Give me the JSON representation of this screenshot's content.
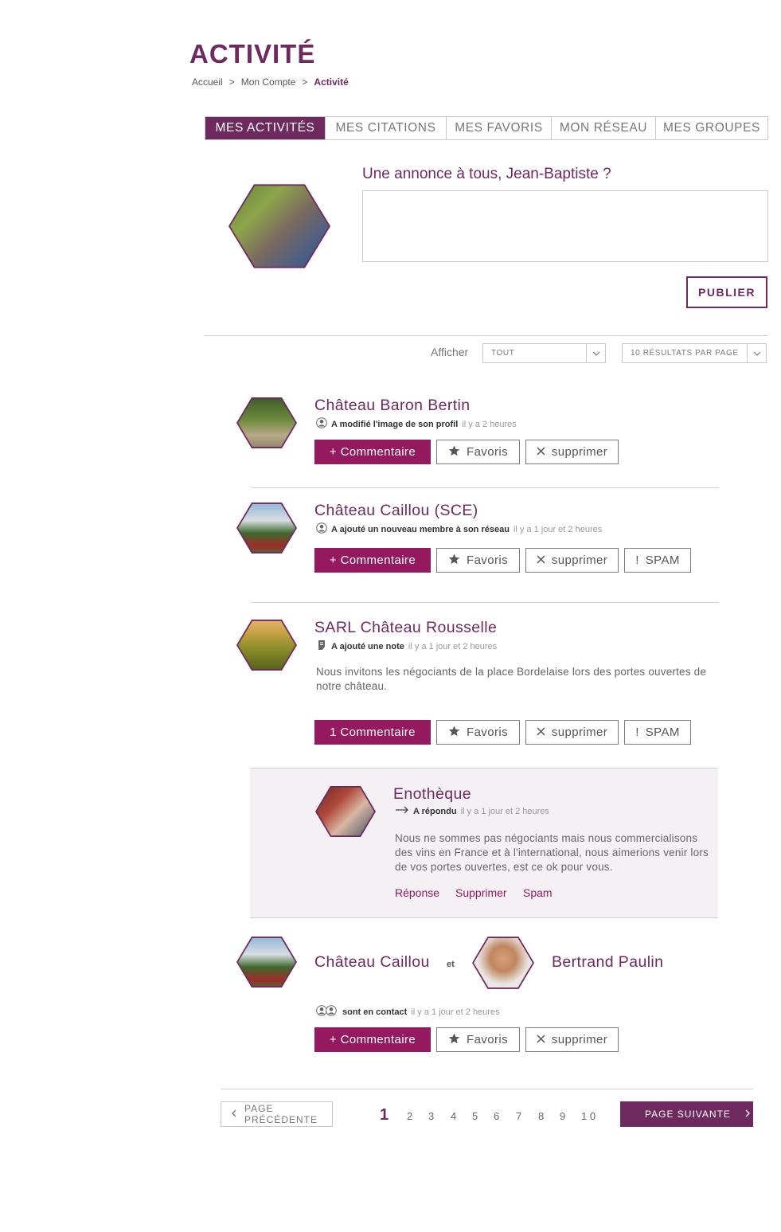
{
  "page": {
    "title": "ACTIVITÉ",
    "breadcrumb": [
      "Accueil",
      ">",
      "Mon Compte",
      ">",
      "Activité"
    ]
  },
  "tabs": [
    "MES ACTIVITÉS",
    "MES CITATIONS",
    "MES FAVORIS",
    "MON RÉSEAU",
    "MES GROUPES"
  ],
  "composer": {
    "label": "Une annonce à tous, Jean-Baptiste ?",
    "value": "",
    "publish": "PUBLIER"
  },
  "filters": {
    "afficher": "Afficher",
    "type": "TOUT",
    "per_page": "10 RÉSULTATS PAR PAGE"
  },
  "feed": [
    {
      "name": "Château Baron Bertin",
      "action": "A modifié l'image de son profil",
      "time": "il y a  2 heures",
      "buttons": [
        "+ Commentaire",
        "Favoris",
        "supprimer"
      ]
    },
    {
      "name": "Château Caillou (SCE)",
      "action": "A ajouté un nouveau membre à son réseau",
      "time": "il y a 1 jour et 2 heures",
      "buttons": [
        "+ Commentaire",
        "Favoris",
        "supprimer",
        "SPAM"
      ]
    },
    {
      "name": "SARL Château Rousselle",
      "action": "A ajouté une note",
      "time": "il y a 1 jour et 2 heures",
      "text": "Nous invitons les négociants de la place Bordelaise lors des portes ouvertes de notre château.",
      "buttons": [
        "1  Commentaire",
        "Favoris",
        "supprimer",
        "SPAM"
      ]
    },
    {
      "name": "Enothèque",
      "action": "A répondu",
      "time": "il y a 1 jour et 2 heures",
      "text": "Nous ne sommes pas négociants mais nous commercialisons des vins en France et à l'international, nous aimerions venir lors de vos portes ouvertes, est ce ok pour vous.",
      "links": [
        "Réponse",
        "Supprimer",
        "Spam"
      ]
    },
    {
      "name": "Château Caillou",
      "connector": "et",
      "name2": "Bertrand Paulin",
      "action": "sont en contact",
      "time": "il y a 1 jour et 2 heures",
      "buttons": [
        "+ Commentaire",
        "Favoris",
        "supprimer"
      ]
    }
  ],
  "pagination": {
    "prev": "PAGE PRÉCÉDENTE",
    "next": "PAGE SUIVANTE",
    "pages": [
      "1",
      "2",
      "3",
      "4",
      "5",
      "6",
      "7",
      "8",
      "9",
      "1 0"
    ],
    "current": 1
  },
  "colors": {
    "brand": "#6e2a5e",
    "accent": "#94195e",
    "reply_bg": "#f5f0f3"
  }
}
